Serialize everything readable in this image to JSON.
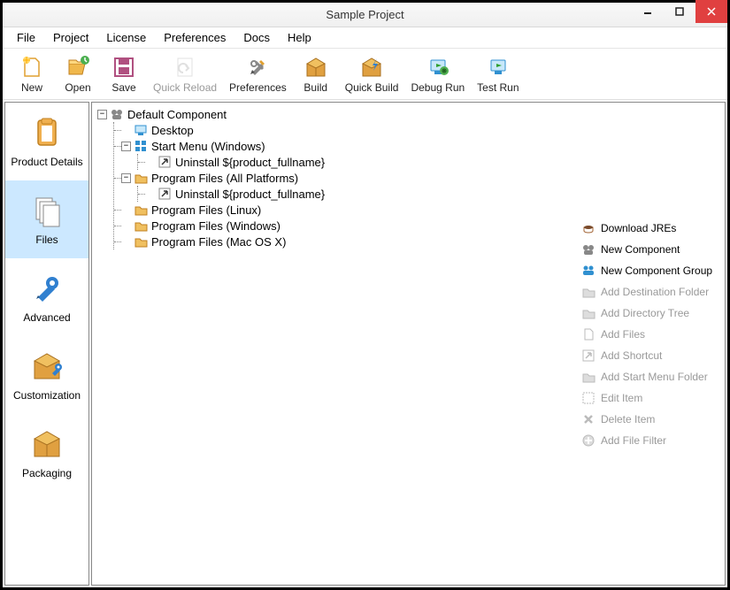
{
  "window": {
    "title": "Sample Project"
  },
  "menu": [
    "File",
    "Project",
    "License",
    "Preferences",
    "Docs",
    "Help"
  ],
  "toolbar": [
    {
      "id": "new",
      "label": "New",
      "enabled": true
    },
    {
      "id": "open",
      "label": "Open",
      "enabled": true
    },
    {
      "id": "save",
      "label": "Save",
      "enabled": true
    },
    {
      "id": "quick-reload",
      "label": "Quick Reload",
      "enabled": false
    },
    {
      "id": "preferences",
      "label": "Preferences",
      "enabled": true
    },
    {
      "id": "build",
      "label": "Build",
      "enabled": true
    },
    {
      "id": "quick-build",
      "label": "Quick Build",
      "enabled": true
    },
    {
      "id": "debug-run",
      "label": "Debug Run",
      "enabled": true
    },
    {
      "id": "test-run",
      "label": "Test Run",
      "enabled": true
    }
  ],
  "sidebar": [
    {
      "id": "product-details",
      "label": "Product Details"
    },
    {
      "id": "files",
      "label": "Files",
      "selected": true
    },
    {
      "id": "advanced",
      "label": "Advanced"
    },
    {
      "id": "customization",
      "label": "Customization"
    },
    {
      "id": "packaging",
      "label": "Packaging"
    }
  ],
  "tree": {
    "root": {
      "label": "Default Component",
      "icon": "component",
      "expanded": true,
      "children": [
        {
          "label": "Desktop",
          "icon": "desktop",
          "children": null
        },
        {
          "label": "Start Menu (Windows)",
          "icon": "startmenu",
          "expanded": true,
          "children": [
            {
              "label": "Uninstall ${product_fullname}",
              "icon": "shortcut",
              "children": null
            }
          ]
        },
        {
          "label": "Program Files (All Platforms)",
          "icon": "folder",
          "expanded": true,
          "children": [
            {
              "label": "Uninstall ${product_fullname}",
              "icon": "shortcut",
              "children": null
            }
          ]
        },
        {
          "label": "Program Files (Linux)",
          "icon": "folder",
          "children": null
        },
        {
          "label": "Program Files (Windows)",
          "icon": "folder",
          "children": null
        },
        {
          "label": "Program Files (Mac OS X)",
          "icon": "folder",
          "children": null
        }
      ]
    }
  },
  "actions": [
    {
      "id": "download-jres",
      "label": "Download JREs",
      "enabled": true,
      "icon": "coffee"
    },
    {
      "id": "new-component",
      "label": "New Component",
      "enabled": true,
      "icon": "component"
    },
    {
      "id": "new-component-group",
      "label": "New Component Group",
      "enabled": true,
      "icon": "group"
    },
    {
      "id": "add-destination-folder",
      "label": "Add Destination Folder",
      "enabled": false,
      "icon": "folder"
    },
    {
      "id": "add-directory-tree",
      "label": "Add Directory Tree",
      "enabled": false,
      "icon": "folder"
    },
    {
      "id": "add-files",
      "label": "Add Files",
      "enabled": false,
      "icon": "file"
    },
    {
      "id": "add-shortcut",
      "label": "Add Shortcut",
      "enabled": false,
      "icon": "shortcut"
    },
    {
      "id": "add-start-menu-folder",
      "label": "Add Start Menu Folder",
      "enabled": false,
      "icon": "folder"
    },
    {
      "id": "edit-item",
      "label": "Edit Item",
      "enabled": false,
      "icon": "edit"
    },
    {
      "id": "delete-item",
      "label": "Delete Item",
      "enabled": false,
      "icon": "delete"
    },
    {
      "id": "add-file-filter",
      "label": "Add File Filter",
      "enabled": false,
      "icon": "filter"
    }
  ]
}
